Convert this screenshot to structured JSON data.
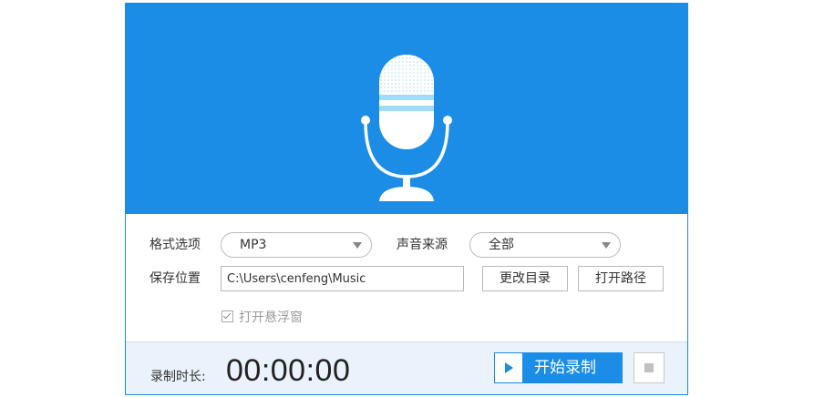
{
  "form": {
    "format_label": "格式选项",
    "format_value": "MP3",
    "source_label": "声音来源",
    "source_value": "全部",
    "save_label": "保存位置",
    "save_path": "C:\\Users\\cenfeng\\Music",
    "change_dir_label": "更改目录",
    "open_path_label": "打开路径",
    "floating_window_label": "打开悬浮窗",
    "floating_window_checked": true
  },
  "footer": {
    "duration_label": "录制时长:",
    "duration_value": "00:00:00",
    "start_label": "开始录制"
  },
  "icons": {
    "hero": "microphone-icon",
    "dropdown": "chevron-down-icon",
    "play": "play-icon",
    "stop": "stop-icon"
  },
  "colors": {
    "accent": "#1b8de6",
    "footer_bg": "#eaf3fb",
    "mic_stripe": "#9fdcf7"
  }
}
